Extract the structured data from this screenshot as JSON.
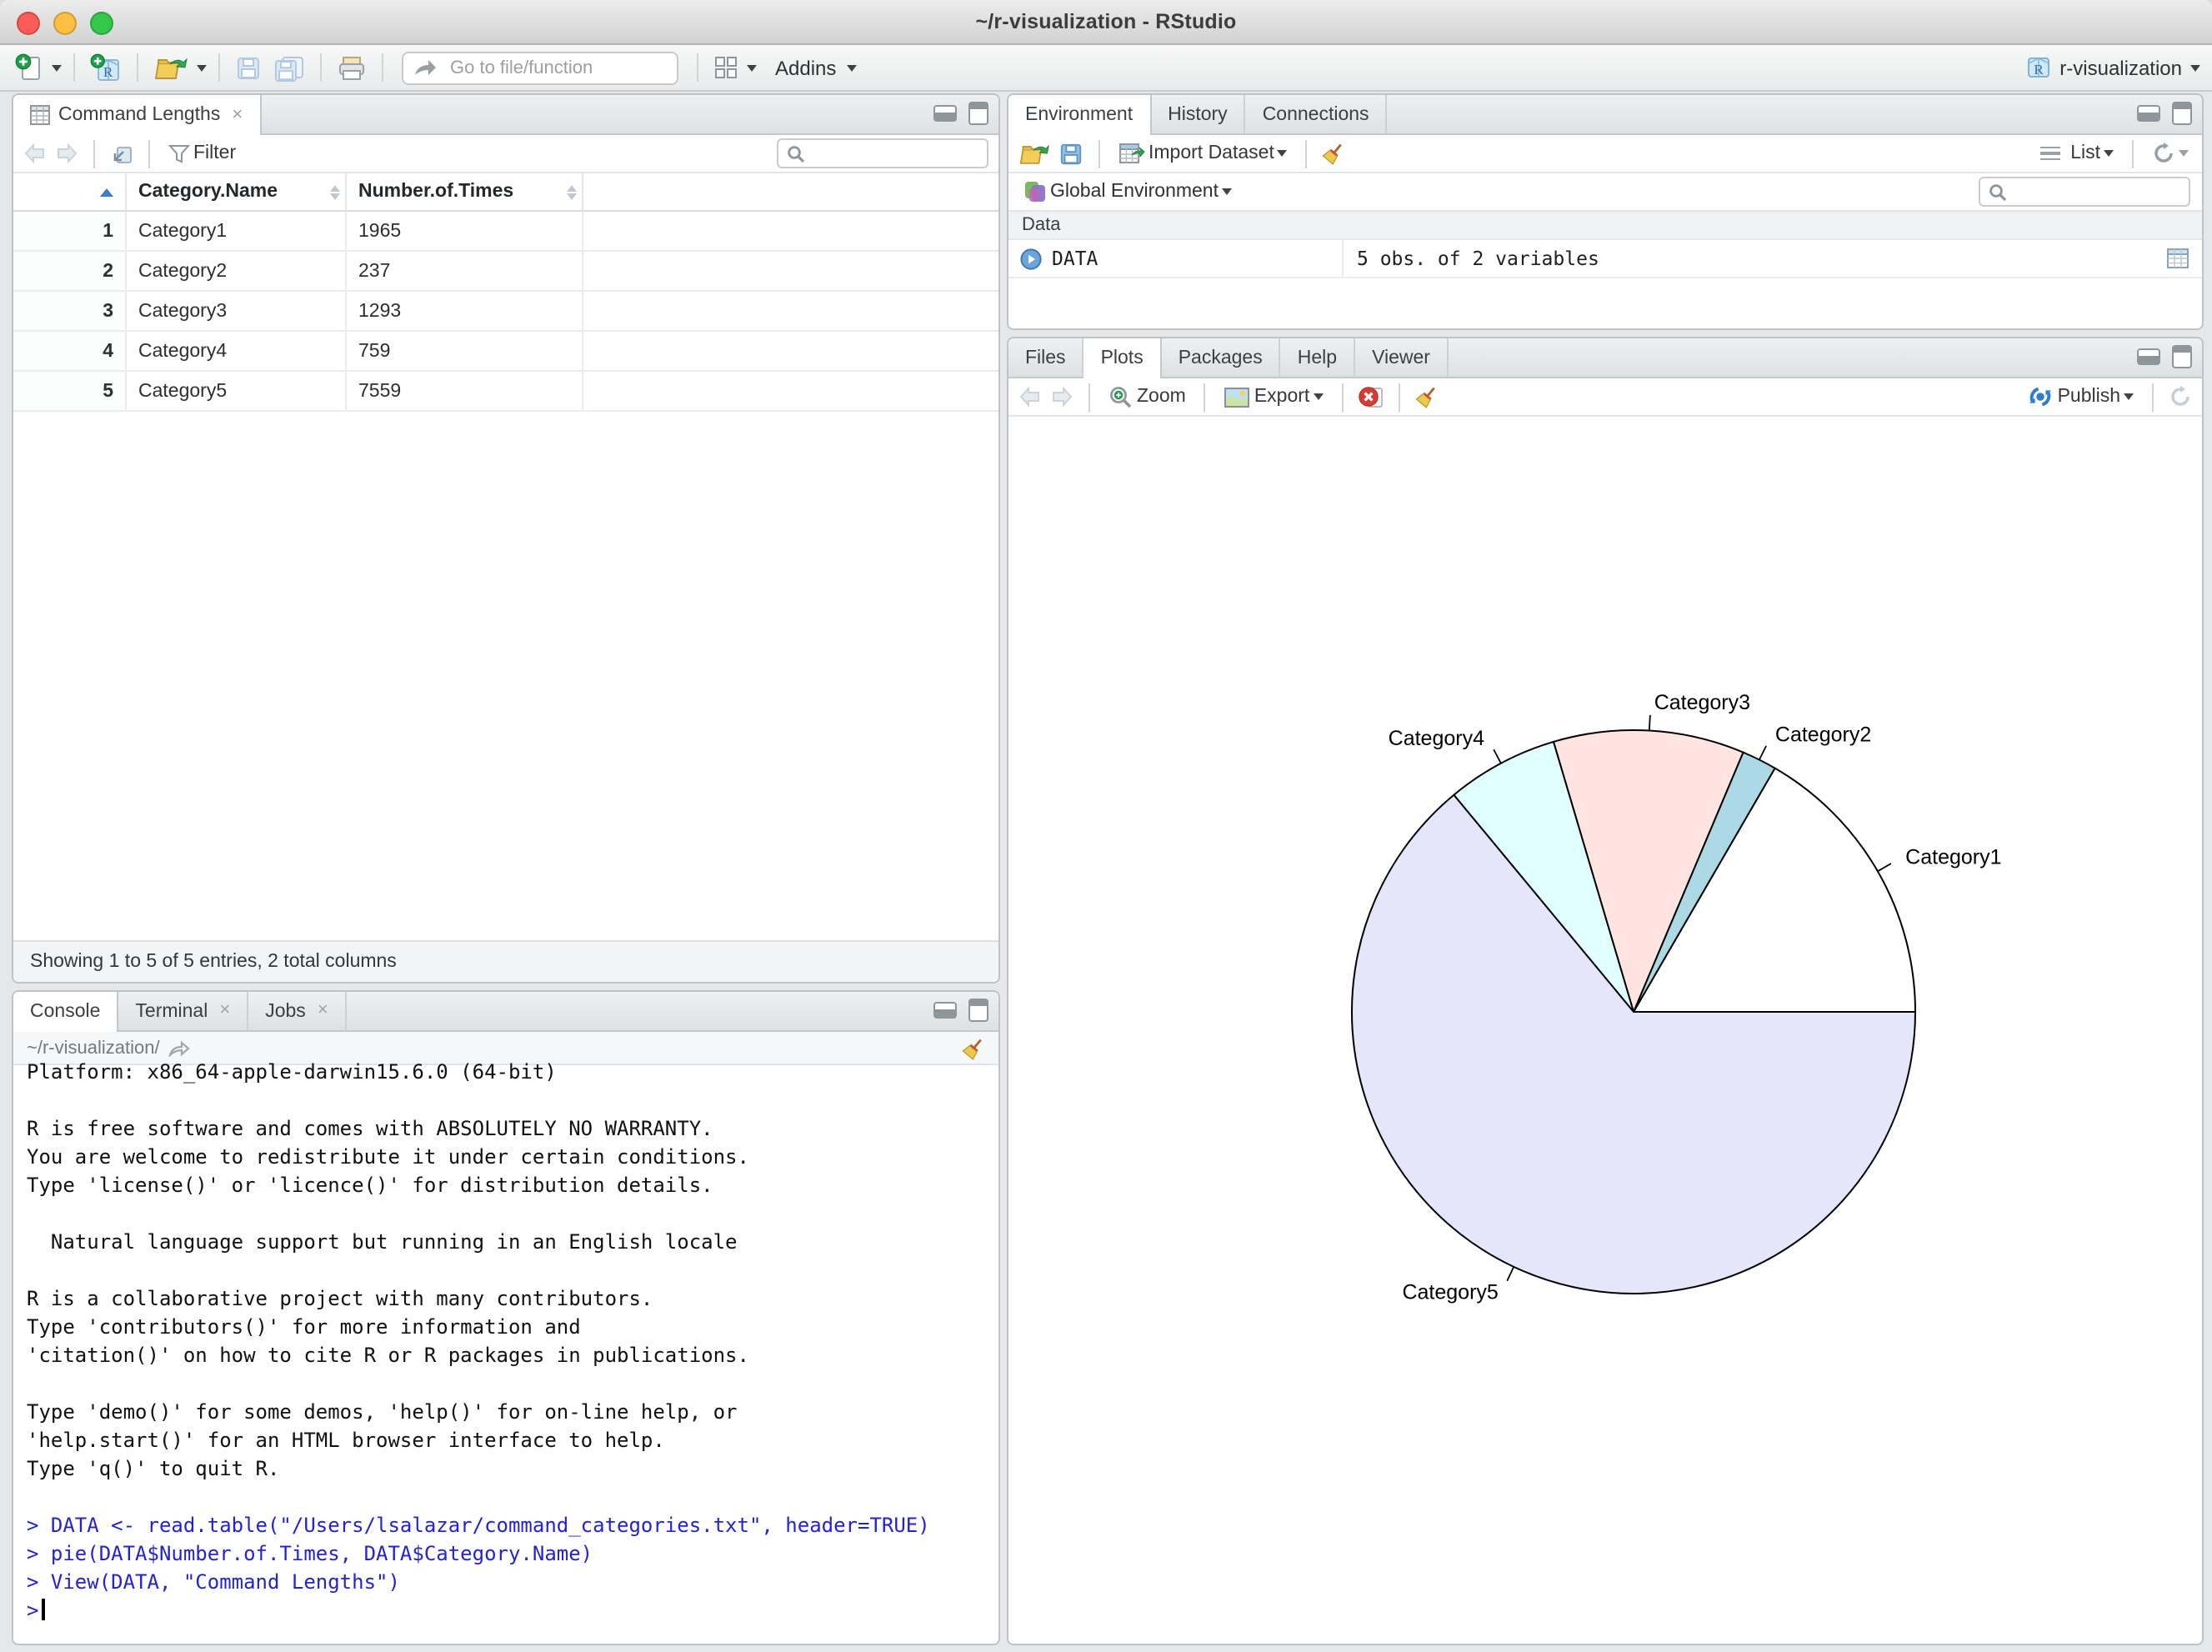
{
  "window": {
    "title": "~/r-visualization - RStudio",
    "traffic_light_colors": {
      "close": "#fc5b57",
      "minimize": "#fdbe41",
      "zoom": "#34c84a"
    }
  },
  "icons": {
    "close": "×",
    "r-cube": "R"
  },
  "toolbar": {
    "goto_placeholder": "Go to file/function",
    "addins_label": "Addins",
    "project_label": "r-visualization"
  },
  "viewer": {
    "tab_label": "Command Lengths",
    "filter_label": "Filter",
    "columns": [
      "Category.Name",
      "Number.of.Times"
    ],
    "rows": [
      {
        "n": "1",
        "name": "Category1",
        "times": "1965"
      },
      {
        "n": "2",
        "name": "Category2",
        "times": "237"
      },
      {
        "n": "3",
        "name": "Category3",
        "times": "1293"
      },
      {
        "n": "4",
        "name": "Category4",
        "times": "759"
      },
      {
        "n": "5",
        "name": "Category5",
        "times": "7559"
      }
    ],
    "footer": "Showing 1 to 5 of 5 entries, 2 total columns"
  },
  "console": {
    "tabs": [
      {
        "label": "Console",
        "closable": false
      },
      {
        "label": "Terminal",
        "closable": true
      },
      {
        "label": "Jobs",
        "closable": true
      }
    ],
    "path": "~/r-visualization/",
    "lines": [
      {
        "style": "output",
        "text": "Platform: x86_64-apple-darwin15.6.0 (64-bit)"
      },
      {
        "style": "output",
        "text": ""
      },
      {
        "style": "output",
        "text": "R is free software and comes with ABSOLUTELY NO WARRANTY."
      },
      {
        "style": "output",
        "text": "You are welcome to redistribute it under certain conditions."
      },
      {
        "style": "output",
        "text": "Type 'license()' or 'licence()' for distribution details."
      },
      {
        "style": "output",
        "text": ""
      },
      {
        "style": "output",
        "text": "  Natural language support but running in an English locale"
      },
      {
        "style": "output",
        "text": ""
      },
      {
        "style": "output",
        "text": "R is a collaborative project with many contributors."
      },
      {
        "style": "output",
        "text": "Type 'contributors()' for more information and"
      },
      {
        "style": "output",
        "text": "'citation()' on how to cite R or R packages in publications."
      },
      {
        "style": "output",
        "text": ""
      },
      {
        "style": "output",
        "text": "Type 'demo()' for some demos, 'help()' for on-line help, or"
      },
      {
        "style": "output",
        "text": "'help.start()' for an HTML browser interface to help."
      },
      {
        "style": "output",
        "text": "Type 'q()' to quit R."
      },
      {
        "style": "output",
        "text": ""
      },
      {
        "style": "input",
        "text": "> DATA <- read.table(\"/Users/lsalazar/command_categories.txt\", header=TRUE)"
      },
      {
        "style": "input",
        "text": "> pie(DATA$Number.of.Times, DATA$Category.Name)"
      },
      {
        "style": "input",
        "text": "> View(DATA, \"Command Lengths\")"
      },
      {
        "style": "input",
        "text": ">",
        "cursor": true
      }
    ]
  },
  "environment": {
    "tabs": [
      "Environment",
      "History",
      "Connections"
    ],
    "import_label": "Import Dataset",
    "list_label": "List",
    "scope_label": "Global Environment",
    "section_label": "Data",
    "object": {
      "name": "DATA",
      "summary": "5 obs. of 2 variables"
    }
  },
  "plots": {
    "tabs": [
      "Files",
      "Plots",
      "Packages",
      "Help",
      "Viewer"
    ],
    "zoom_label": "Zoom",
    "export_label": "Export",
    "publish_label": "Publish"
  },
  "colors": {
    "console_input_blue": "#2323d4",
    "sort_indicator_blue": "#3c7fc0",
    "publish_blue": "#2e7ecf"
  },
  "chart_data": {
    "type": "pie",
    "categories": [
      "Category1",
      "Category2",
      "Category3",
      "Category4",
      "Category5"
    ],
    "values": [
      1965,
      237,
      1293,
      759,
      7559
    ],
    "colors": [
      "#FFFFFF",
      "#ADD8E6",
      "#FFE4E1",
      "#E0FFFF",
      "#E6E6FA"
    ],
    "stroke": "#000000",
    "start_angle_deg": 0,
    "direction": "counterclockwise",
    "title": "",
    "legend": "none"
  }
}
